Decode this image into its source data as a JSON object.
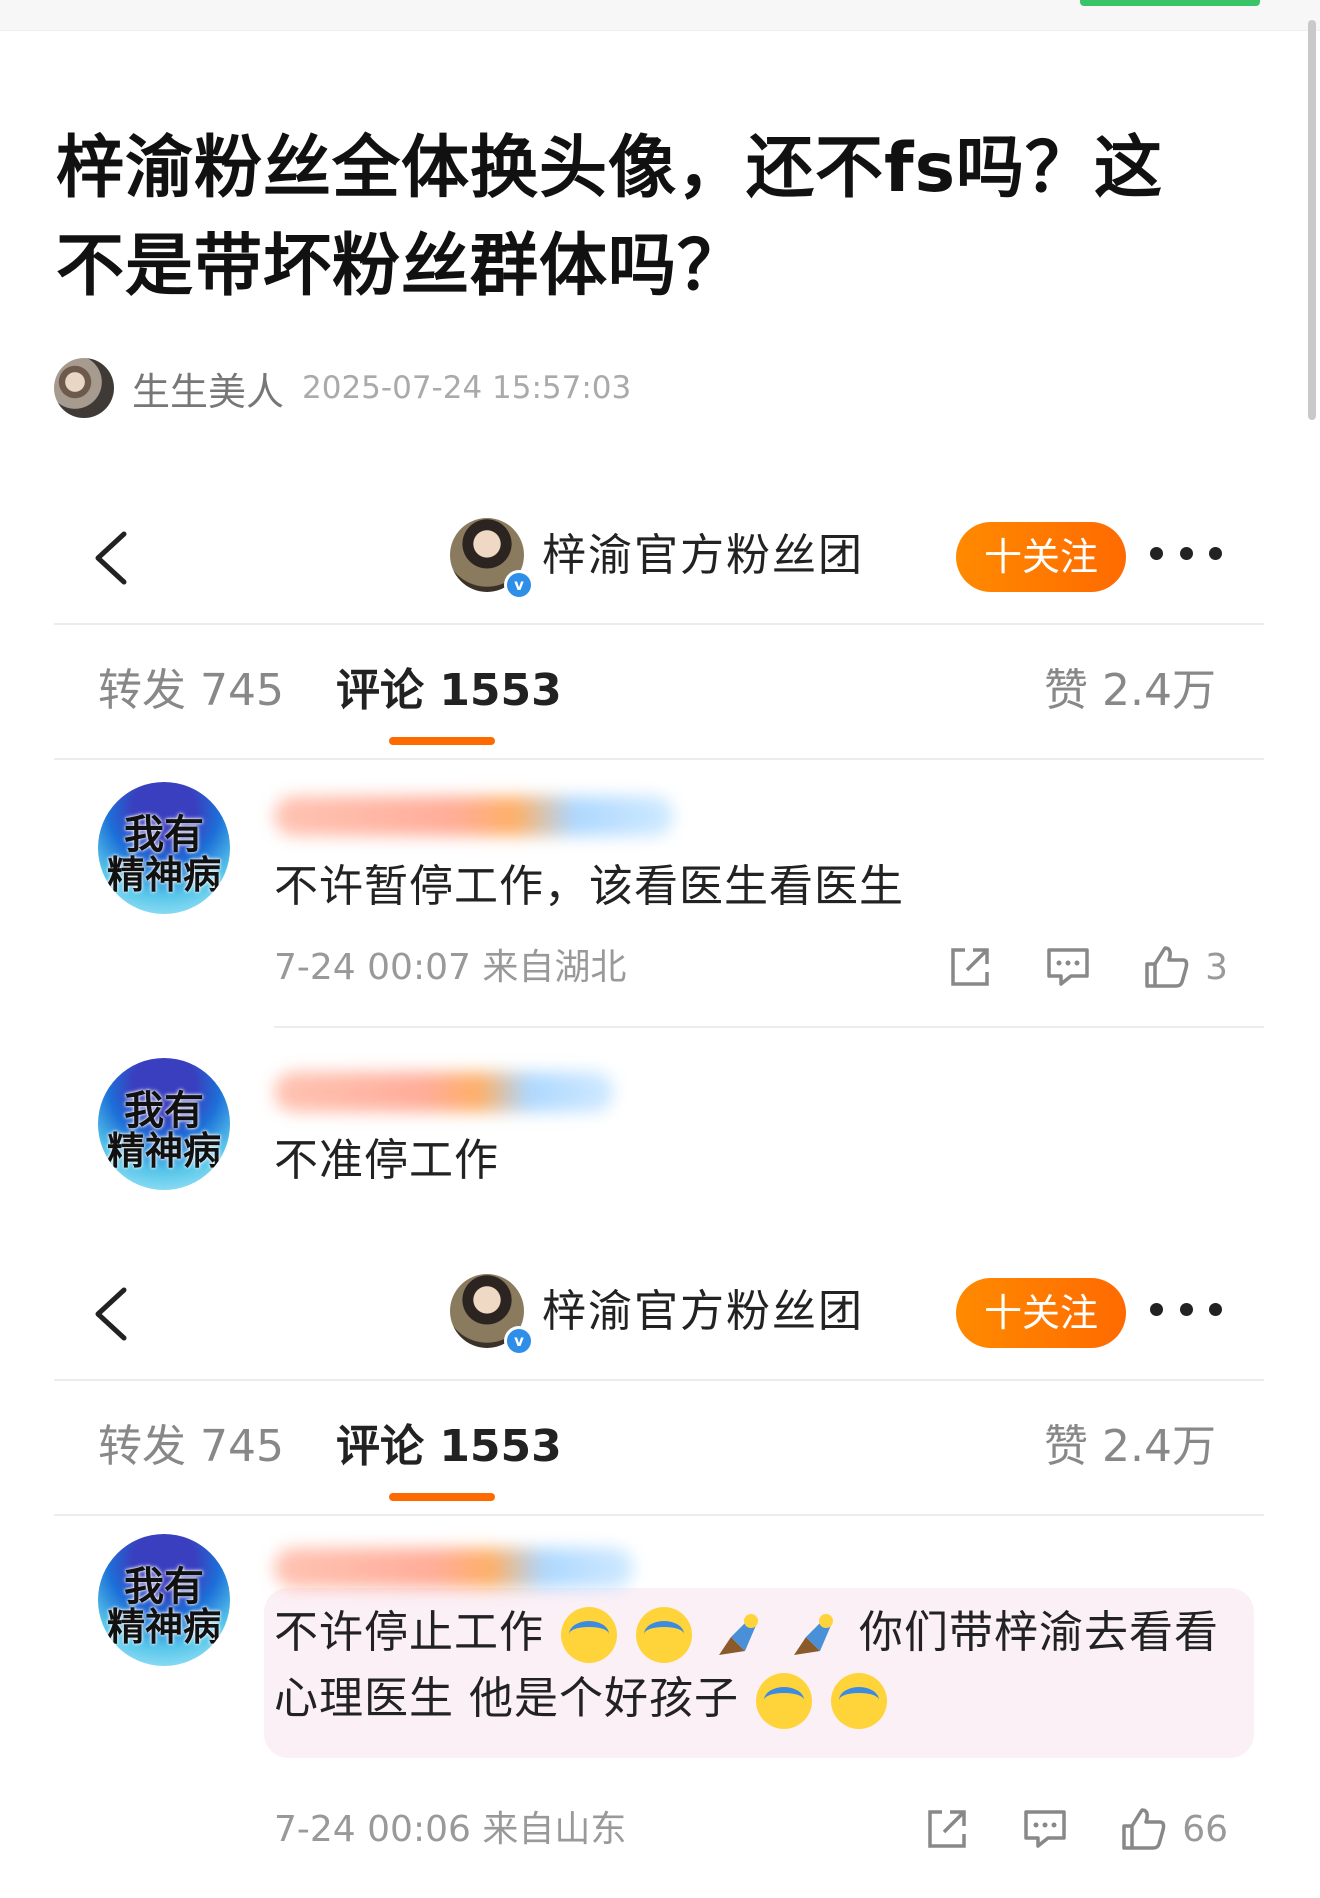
{
  "post": {
    "title": "梓渝粉丝全体换头像，还不fs吗？这不是带坏粉丝群体吗？",
    "author": "生生美人",
    "time": "2025-07-24 15:57:03"
  },
  "screenshots": [
    {
      "account_name": "梓渝官方粉丝团",
      "follow_label": "十关注",
      "tabs": {
        "repost": "转发 745",
        "comment": "评论 1553",
        "like": "赞 2.4万"
      },
      "comments": [
        {
          "avatar_line1": "我有",
          "avatar_line2": "精神病",
          "text": "不许暂停工作，该看医生看医生",
          "meta": "7-24 00:07  来自湖北",
          "likes": "3"
        },
        {
          "avatar_line1": "我有",
          "avatar_line2": "精神病",
          "text": "不准停工作"
        }
      ]
    },
    {
      "account_name": "梓渝官方粉丝团",
      "follow_label": "十关注",
      "tabs": {
        "repost": "转发 745",
        "comment": "评论 1553",
        "like": "赞 2.4万"
      },
      "comments": [
        {
          "avatar_line1": "我有",
          "avatar_line2": "精神病",
          "text_a": "不许停止工作",
          "text_b": "你们带梓渝去看看",
          "text_c": "心理医生 他是个好孩子",
          "meta": "7-24 00:06  来自山东",
          "likes": "66"
        }
      ]
    }
  ],
  "icons": [
    "back-icon",
    "more-icon",
    "verified-icon",
    "share-icon",
    "comment-icon",
    "like-icon",
    "crying-emoji",
    "rocket-emoji"
  ],
  "colors": {
    "accent": "#ff6a00",
    "follow_gradient_start": "#ff8a00"
  }
}
